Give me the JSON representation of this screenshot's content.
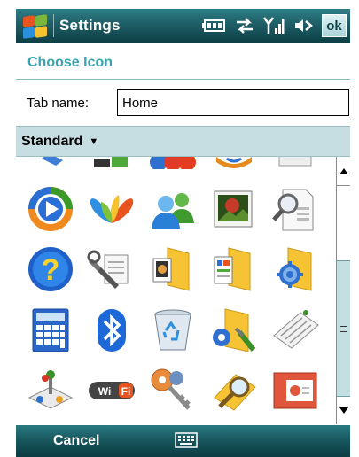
{
  "titlebar": {
    "title": "Settings",
    "ok_label": "ok",
    "icons": [
      "windows-start-icon",
      "battery-icon",
      "sync-connection-icon",
      "signal-strength-icon",
      "speaker-icon"
    ]
  },
  "section": {
    "title": "Choose Icon"
  },
  "tab_name": {
    "label": "Tab name:",
    "value": "Home"
  },
  "category": {
    "selected": "Standard"
  },
  "icons": [
    [
      "partial-top-icon",
      "partial-top-icon",
      "partial-top-icon",
      "partial-top-icon",
      "partial-top-icon"
    ],
    [
      "media-player-icon",
      "messenger-butterfly-icon",
      "contacts-people-icon",
      "picture-viewer-icon",
      "document-search-icon"
    ],
    [
      "help-icon",
      "wrench-settings-icon",
      "pictures-folder-icon",
      "documents-folder-icon",
      "settings-folder-icon"
    ],
    [
      "calculator-icon",
      "bluetooth-icon",
      "recycle-bin-icon",
      "tools-folder-icon",
      "keyboard-input-icon"
    ],
    [
      "game-controller-icon",
      "wifi-icon",
      "keys-security-icon",
      "search-folder-icon",
      "presentation-icon"
    ]
  ],
  "softkeys": {
    "left": "Cancel"
  },
  "colors": {
    "bar_dark": "#0d3f46",
    "bar_mid": "#1f5e66",
    "accent_text": "#3aa3b0",
    "category_bg": "#c6dee1",
    "scroll_thumb": "#c4dfe2"
  }
}
